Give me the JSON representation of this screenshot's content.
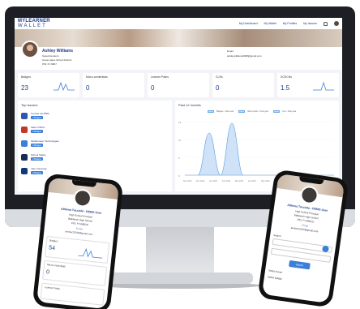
{
  "app": {
    "logo_top": "MYLEARNER",
    "logo_bottom": "WALLET",
    "nav": [
      "My Dashboard",
      "My Wallet",
      "My Profiles",
      "My Issuers"
    ]
  },
  "profile": {
    "name": "Ashley Williams",
    "role": "Superintendent",
    "school": "Great Lakes School District",
    "id": "PID: FY-9827",
    "email_label": "Email",
    "email": "ashleywilliams9008@gmail.com"
  },
  "stats": [
    {
      "label": "Badges",
      "value": "23",
      "icon": "badge-icon"
    },
    {
      "label": "Micro-credentials",
      "value": "0",
      "icon": "micro-credential-icon"
    },
    {
      "label": "Learner Paths",
      "value": "0",
      "icon": "path-icon"
    },
    {
      "label": "CLRs",
      "value": "0",
      "icon": "clr-icon"
    },
    {
      "label": "SCECHs",
      "value": "1.5",
      "icon": "sceches-icon"
    }
  ],
  "issuers": {
    "title": "Top Issuers",
    "items": [
      {
        "name": "Canvas via PBIS",
        "badge": "7 Badges",
        "color": "#2f55b5"
      },
      {
        "name": "Salem ISD/A",
        "badge": "5 Badges",
        "color": "#c0392b"
      },
      {
        "name": "Metaknower Technologies",
        "badge": "3 Badges",
        "color": "#3b7fd9"
      },
      {
        "name": "School Safety",
        "badge": "2 Badges",
        "color": "#1b2b4f"
      },
      {
        "name": "Yale University",
        "badge": "2 Badges",
        "color": "#0f3a7a"
      }
    ]
  },
  "past": {
    "title": "Past 12 months",
    "legend": [
      "Badges - Past year",
      "Micro-creds - Past year",
      "CLs - Past year"
    ],
    "months": [
      "Nov 2022",
      "Dec 2022",
      "Jan 2023",
      "Feb 2023",
      "Mar 2023",
      "Apr 2023",
      "May 2023",
      "Jun 2023",
      "Jul 2023",
      "Aug 2023",
      "Sep 2023",
      "Oct 2023"
    ],
    "y_ticks": [
      "15",
      "10",
      "5",
      "0"
    ]
  },
  "phone_left": {
    "name": "Althena Tucciolo - DEMO User",
    "role": "High School Principal",
    "school": "Blaklanch High School",
    "id": "PID: FY-88BCD",
    "email_label": "Email",
    "email": "anniey12345@gmail.com",
    "badges_label": "Badges",
    "badges_value": "54",
    "micro_label": "Micro-credentials",
    "micro_value": "0",
    "paths_label": "Learner Paths"
  },
  "phone_right": {
    "name": "Althena Tucciolo - DEMO User",
    "role": "High School Principal",
    "school": "Blaklanch High School",
    "id": "PID: FY-88BCD",
    "email_label": "Email",
    "email": "anniey12345@gmail.com",
    "search_label": "Search",
    "button_label": "Search",
    "list": [
      "Select Issuer",
      "Select Badge"
    ]
  }
}
